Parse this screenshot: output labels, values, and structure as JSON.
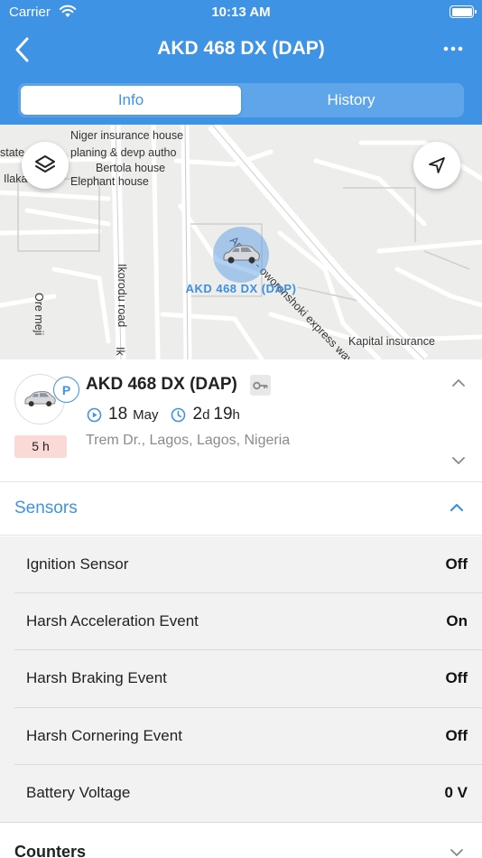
{
  "status_bar": {
    "carrier": "Carrier",
    "time": "10:13 AM"
  },
  "header": {
    "title": "AKD 468 DX (DAP)",
    "back_icon": "chevron-left-icon",
    "more_icon": "more-horizontal-icon",
    "tabs": [
      {
        "label": "Info",
        "active": true
      },
      {
        "label": "History",
        "active": false
      }
    ],
    "colors": {
      "primary": "#3f93e5"
    }
  },
  "map": {
    "labels": [
      "Niger insurance house",
      "planing & devp autho",
      "Bertola house",
      "Elephant house",
      "state",
      "Ilaka",
      "Apapa - oworonshoki express way",
      "Ikorodu road",
      "Ore meji",
      "Ik",
      "Kapital insurance"
    ],
    "marker_label": "AKD 468 DX (DAP)",
    "provider": "Google",
    "layers_icon": "layers-icon",
    "locate_icon": "navigation-arrow-icon"
  },
  "vehicle": {
    "name": "AKD 468 DX (DAP)",
    "status_letter": "P",
    "duration": "5 h",
    "date_day": "18",
    "date_month": "May",
    "elapsed_days": "2",
    "elapsed_days_unit": "d",
    "elapsed_hours": "19",
    "elapsed_hours_unit": "h",
    "address": "Trem Dr., Lagos, Lagos, Nigeria"
  },
  "sensors": {
    "title": "Sensors",
    "items": [
      {
        "name": "Ignition Sensor",
        "value": "Off"
      },
      {
        "name": "Harsh Acceleration Event",
        "value": "On"
      },
      {
        "name": "Harsh Braking Event",
        "value": "Off"
      },
      {
        "name": "Harsh Cornering Event",
        "value": "Off"
      },
      {
        "name": "Battery Voltage",
        "value": "0 V"
      }
    ]
  },
  "counters": {
    "title": "Counters"
  }
}
